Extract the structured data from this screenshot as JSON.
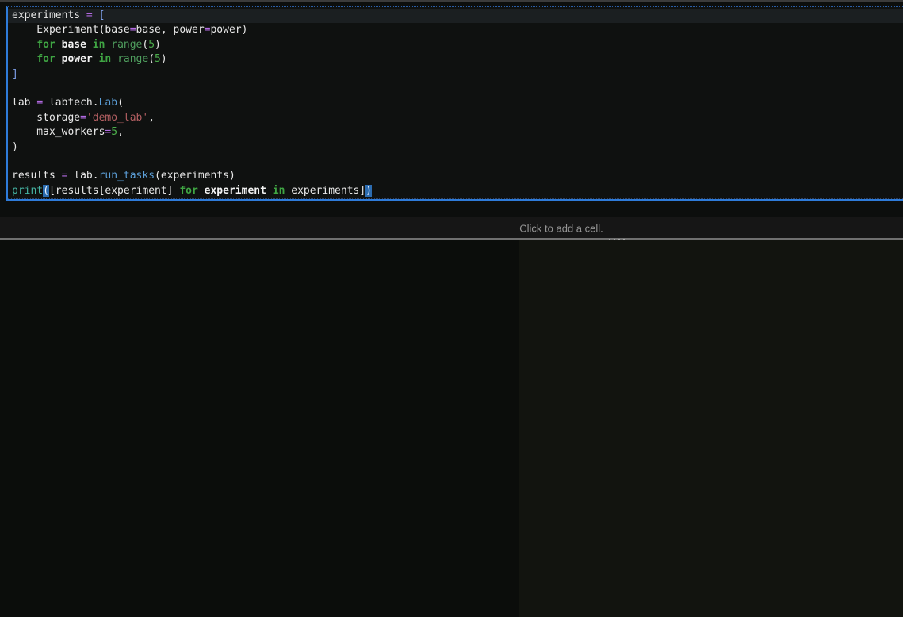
{
  "cell": {
    "type": "code",
    "language": "python",
    "active_line": 1,
    "lines": [
      [
        {
          "t": "experiments ",
          "c": "plain"
        },
        {
          "t": "=",
          "c": "op"
        },
        {
          "t": " ",
          "c": "plain"
        },
        {
          "t": "[",
          "c": "brkt"
        }
      ],
      [
        {
          "t": "    Experiment(base",
          "c": "plain"
        },
        {
          "t": "=",
          "c": "op"
        },
        {
          "t": "base, power",
          "c": "plain"
        },
        {
          "t": "=",
          "c": "op"
        },
        {
          "t": "power)",
          "c": "plain"
        }
      ],
      [
        {
          "t": "    ",
          "c": "plain"
        },
        {
          "t": "for",
          "c": "kw"
        },
        {
          "t": " ",
          "c": "plain"
        },
        {
          "t": "base",
          "c": "var"
        },
        {
          "t": " ",
          "c": "plain"
        },
        {
          "t": "in",
          "c": "kw"
        },
        {
          "t": " ",
          "c": "plain"
        },
        {
          "t": "range",
          "c": "range"
        },
        {
          "t": "(",
          "c": "plain"
        },
        {
          "t": "5",
          "c": "num"
        },
        {
          "t": ")",
          "c": "plain"
        }
      ],
      [
        {
          "t": "    ",
          "c": "plain"
        },
        {
          "t": "for",
          "c": "kw"
        },
        {
          "t": " ",
          "c": "plain"
        },
        {
          "t": "power",
          "c": "var"
        },
        {
          "t": " ",
          "c": "plain"
        },
        {
          "t": "in",
          "c": "kw"
        },
        {
          "t": " ",
          "c": "plain"
        },
        {
          "t": "range",
          "c": "range"
        },
        {
          "t": "(",
          "c": "plain"
        },
        {
          "t": "5",
          "c": "num"
        },
        {
          "t": ")",
          "c": "plain"
        }
      ],
      [
        {
          "t": "]",
          "c": "brkt"
        }
      ],
      [],
      [
        {
          "t": "lab ",
          "c": "plain"
        },
        {
          "t": "=",
          "c": "op"
        },
        {
          "t": " labtech.",
          "c": "plain"
        },
        {
          "t": "Lab",
          "c": "fn"
        },
        {
          "t": "(",
          "c": "plain"
        }
      ],
      [
        {
          "t": "    storage",
          "c": "plain"
        },
        {
          "t": "=",
          "c": "op"
        },
        {
          "t": "'demo_lab'",
          "c": "str"
        },
        {
          "t": ",",
          "c": "plain"
        }
      ],
      [
        {
          "t": "    max_workers",
          "c": "plain"
        },
        {
          "t": "=",
          "c": "op"
        },
        {
          "t": "5",
          "c": "num"
        },
        {
          "t": ",",
          "c": "plain"
        }
      ],
      [
        {
          "t": ")",
          "c": "plain"
        }
      ],
      [],
      [
        {
          "t": "results ",
          "c": "plain"
        },
        {
          "t": "=",
          "c": "op"
        },
        {
          "t": " lab.",
          "c": "plain"
        },
        {
          "t": "run_tasks",
          "c": "fn"
        },
        {
          "t": "(experiments)",
          "c": "plain"
        }
      ],
      [
        {
          "t": "print",
          "c": "builtin"
        },
        {
          "t": "(",
          "c": "match"
        },
        {
          "t": "[results[experiment] ",
          "c": "plain"
        },
        {
          "t": "for",
          "c": "kw"
        },
        {
          "t": " ",
          "c": "plain"
        },
        {
          "t": "experiment",
          "c": "var"
        },
        {
          "t": " ",
          "c": "plain"
        },
        {
          "t": "in",
          "c": "kw"
        },
        {
          "t": " experiments]",
          "c": "plain"
        },
        {
          "t": ")",
          "c": "match"
        }
      ]
    ]
  },
  "add_cell": {
    "label": "Click to add a cell."
  },
  "colors": {
    "cell_border_blue": "#2e7bd9",
    "cell_background": "#0f1110",
    "active_line_background": "#1b1f21",
    "page_background": "#0c0e0d",
    "pane_left_background": "#0b0d0b",
    "pane_right_background": "#12140f",
    "match_paren_background": "#2c6cb0",
    "operator_purple": "#b36ae2",
    "keyword_green": "#3fa543",
    "function_blue": "#5c9fd8",
    "builtin_teal": "#45b3a2",
    "string_red": "#b35f62",
    "number_green": "#4cae4c",
    "bracket_blue": "#7d9fe8",
    "add_cell_text_gray": "#969696",
    "divider_gray": "#707070"
  }
}
